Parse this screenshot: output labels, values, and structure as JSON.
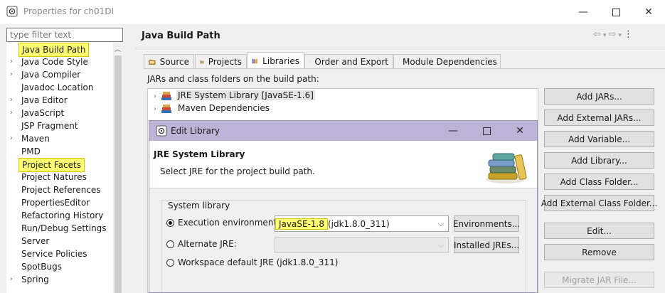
{
  "window": {
    "title": "Properties for ch01DI",
    "minimize_glyph": "—",
    "close_glyph": "✕"
  },
  "left_pane": {
    "filter_placeholder": "type filter text",
    "items": [
      {
        "label": "Java Build Path",
        "expandable": false,
        "highlighted": true
      },
      {
        "label": "Java Code Style",
        "expandable": true,
        "highlighted": false
      },
      {
        "label": "Java Compiler",
        "expandable": true,
        "highlighted": false
      },
      {
        "label": "Javadoc Location",
        "expandable": false,
        "highlighted": false
      },
      {
        "label": "Java Editor",
        "expandable": true,
        "highlighted": false
      },
      {
        "label": "JavaScript",
        "expandable": true,
        "highlighted": false
      },
      {
        "label": "JSP Fragment",
        "expandable": false,
        "highlighted": false
      },
      {
        "label": "Maven",
        "expandable": true,
        "highlighted": false
      },
      {
        "label": "PMD",
        "expandable": false,
        "highlighted": false
      },
      {
        "label": "Project Facets",
        "expandable": false,
        "highlighted": true
      },
      {
        "label": "Project Natures",
        "expandable": false,
        "highlighted": false
      },
      {
        "label": "Project References",
        "expandable": false,
        "highlighted": false
      },
      {
        "label": "PropertiesEditor",
        "expandable": false,
        "highlighted": false
      },
      {
        "label": "Refactoring History",
        "expandable": false,
        "highlighted": false
      },
      {
        "label": "Run/Debug Settings",
        "expandable": false,
        "highlighted": false
      },
      {
        "label": "Server",
        "expandable": false,
        "highlighted": false
      },
      {
        "label": "Service Policies",
        "expandable": false,
        "highlighted": false
      },
      {
        "label": "SpotBugs",
        "expandable": false,
        "highlighted": false
      },
      {
        "label": "Spring",
        "expandable": true,
        "highlighted": false
      }
    ]
  },
  "main": {
    "page_title": "Java Build Path",
    "tabs": [
      {
        "label": "Source",
        "active": false
      },
      {
        "label": "Projects",
        "active": false
      },
      {
        "label": "Libraries",
        "active": true
      },
      {
        "label": "Order and Export",
        "active": false
      },
      {
        "label": "Module Dependencies",
        "active": false
      }
    ],
    "jar_label": "JARs and class folders on the build path:",
    "build_path_entries": [
      {
        "label": "JRE System Library [JavaSE-1.6]",
        "selected": true
      },
      {
        "label": "Maven Dependencies",
        "selected": false
      }
    ],
    "buttons": [
      {
        "label": "Add JARs...",
        "enabled": true
      },
      {
        "label": "Add External JARs...",
        "enabled": true
      },
      {
        "label": "Add Variable...",
        "enabled": true
      },
      {
        "label": "Add Library...",
        "enabled": true
      },
      {
        "label": "Add Class Folder...",
        "enabled": true
      },
      {
        "label": "Add External Class Folder...",
        "enabled": true
      },
      {
        "label": "Edit...",
        "enabled": true
      },
      {
        "label": "Remove",
        "enabled": true
      },
      {
        "label": "Migrate JAR File...",
        "enabled": false
      }
    ]
  },
  "dialog": {
    "title": "Edit Library",
    "heading": "JRE System Library",
    "description": "Select JRE for the project build path.",
    "group_label": "System library",
    "options": [
      {
        "label": "Execution environment:",
        "selected": true,
        "combo_highlight": "JavaSE-1.8",
        "combo_rest": " (jdk1.8.0_311)",
        "button": "Environments..."
      },
      {
        "label": "Alternate JRE:",
        "selected": false,
        "combo_highlight": "",
        "combo_rest": "",
        "button": "Installed JREs..."
      },
      {
        "label": "Workspace default JRE (jdk1.8.0_311)",
        "selected": false
      }
    ]
  },
  "colors": {
    "highlight": "#fffe70",
    "dialog_titlebar": "#bcb4d6"
  }
}
